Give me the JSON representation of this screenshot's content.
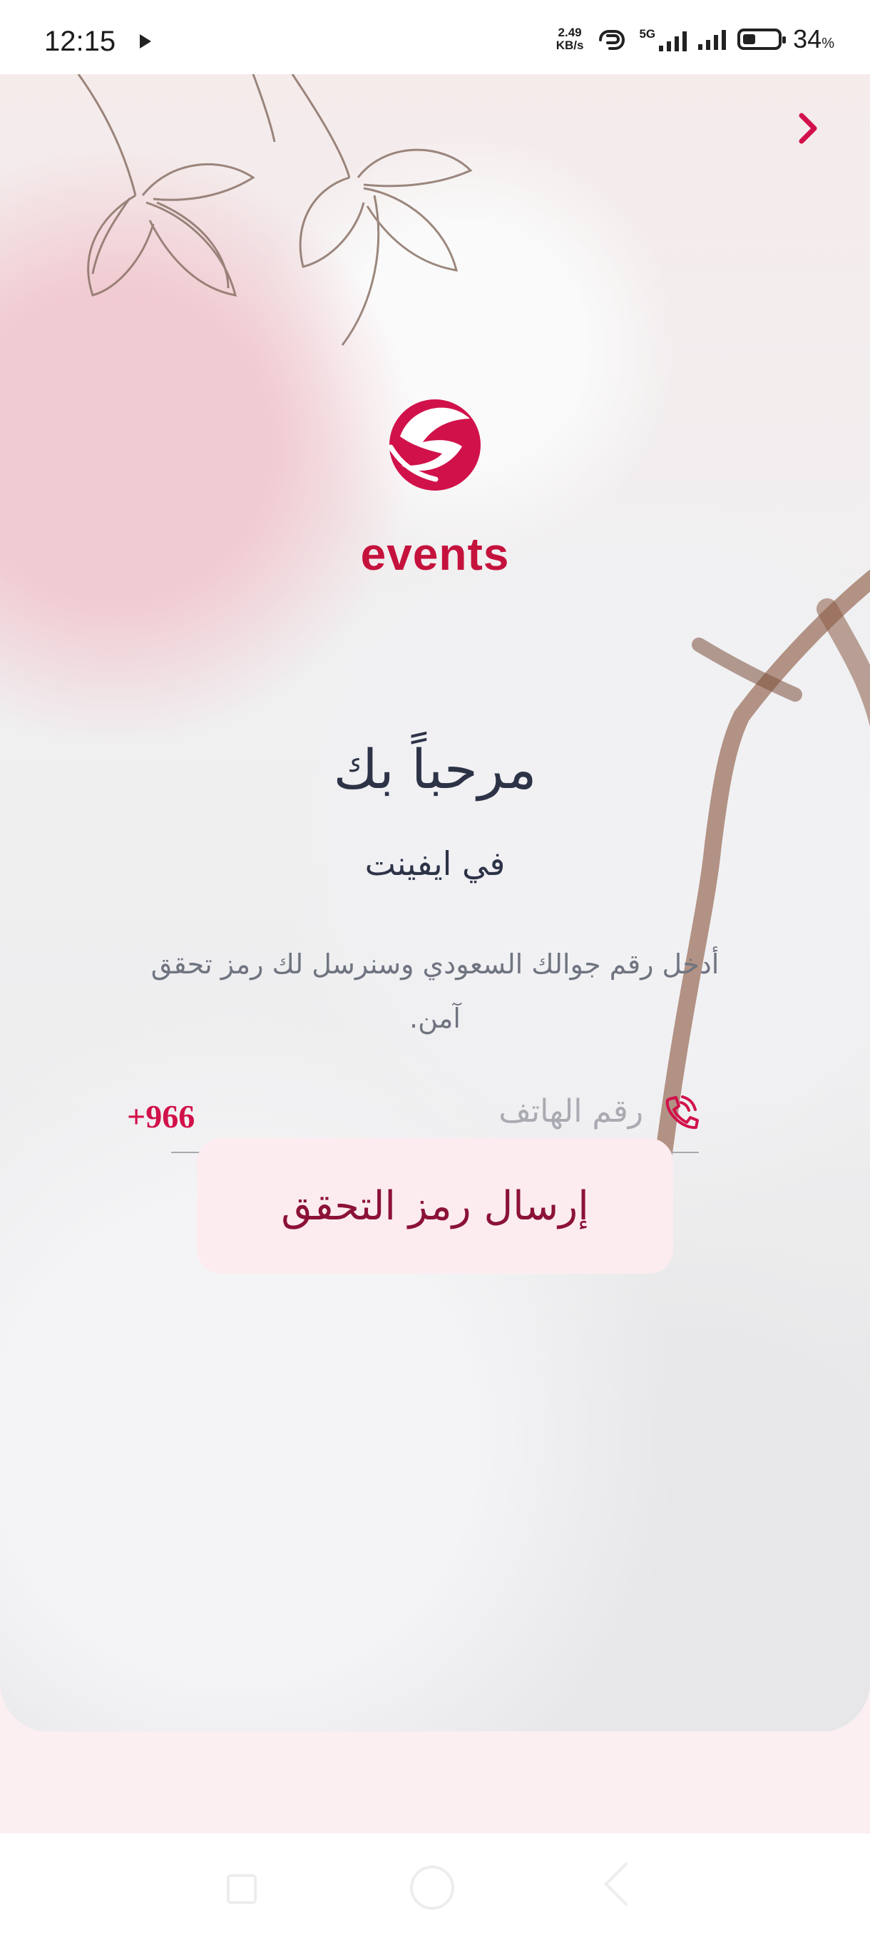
{
  "status_bar": {
    "time": "12:15",
    "network_speed_value": "2.49",
    "network_speed_unit": "KB/s",
    "network_type": "5G",
    "battery_value": "34",
    "battery_unit": "%"
  },
  "header": {
    "back_icon": "chevron-right-icon"
  },
  "brand": {
    "name": "events",
    "color": "#c5123d"
  },
  "welcome": {
    "title": "مرحباً بك",
    "subtitle": "في ايفينت",
    "instruction_line1": "أدخل رقم جوالك السعودي وسنرسل لك رمز تحقق",
    "instruction_line2": "آمن."
  },
  "phone": {
    "country_code": "+966",
    "placeholder": "رقم الهاتف",
    "icon": "phone-icon"
  },
  "actions": {
    "send_code": "إرسال رمز التحقق"
  },
  "navigation": {
    "recent_icon": "recent-apps-icon",
    "home_icon": "home-icon",
    "back_icon": "back-icon"
  }
}
